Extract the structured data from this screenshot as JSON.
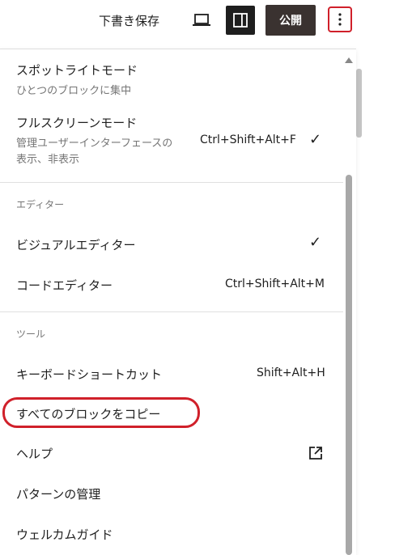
{
  "toolbar": {
    "save_draft": "下書き保存",
    "publish": "公開"
  },
  "menu": {
    "view_items": [
      {
        "label": "スポットライトモード",
        "desc": "ひとつのブロックに集中"
      },
      {
        "label": "フルスクリーンモード",
        "desc": "管理ユーザーインターフェースの表示、非表示",
        "shortcut": "Ctrl+Shift+Alt+F",
        "checked": "✓"
      }
    ],
    "editor_heading": "エディター",
    "editor_items": [
      {
        "label": "ビジュアルエディター",
        "checked": "✓"
      },
      {
        "label": "コードエディター",
        "shortcut": "Ctrl+Shift+Alt+M"
      }
    ],
    "tools_heading": "ツール",
    "tools_items": [
      {
        "label": "キーボードショートカット",
        "shortcut": "Shift+Alt+H"
      },
      {
        "label": "すべてのブロックをコピー"
      },
      {
        "label": "ヘルプ",
        "icon": "external-link-icon"
      },
      {
        "label": "パターンの管理"
      },
      {
        "label": "ウェルカムガイド"
      }
    ]
  },
  "colors": {
    "accent_annotation": "#d0202a",
    "publish_bg": "#3a3230",
    "settings_bg": "#1e1e1e"
  }
}
